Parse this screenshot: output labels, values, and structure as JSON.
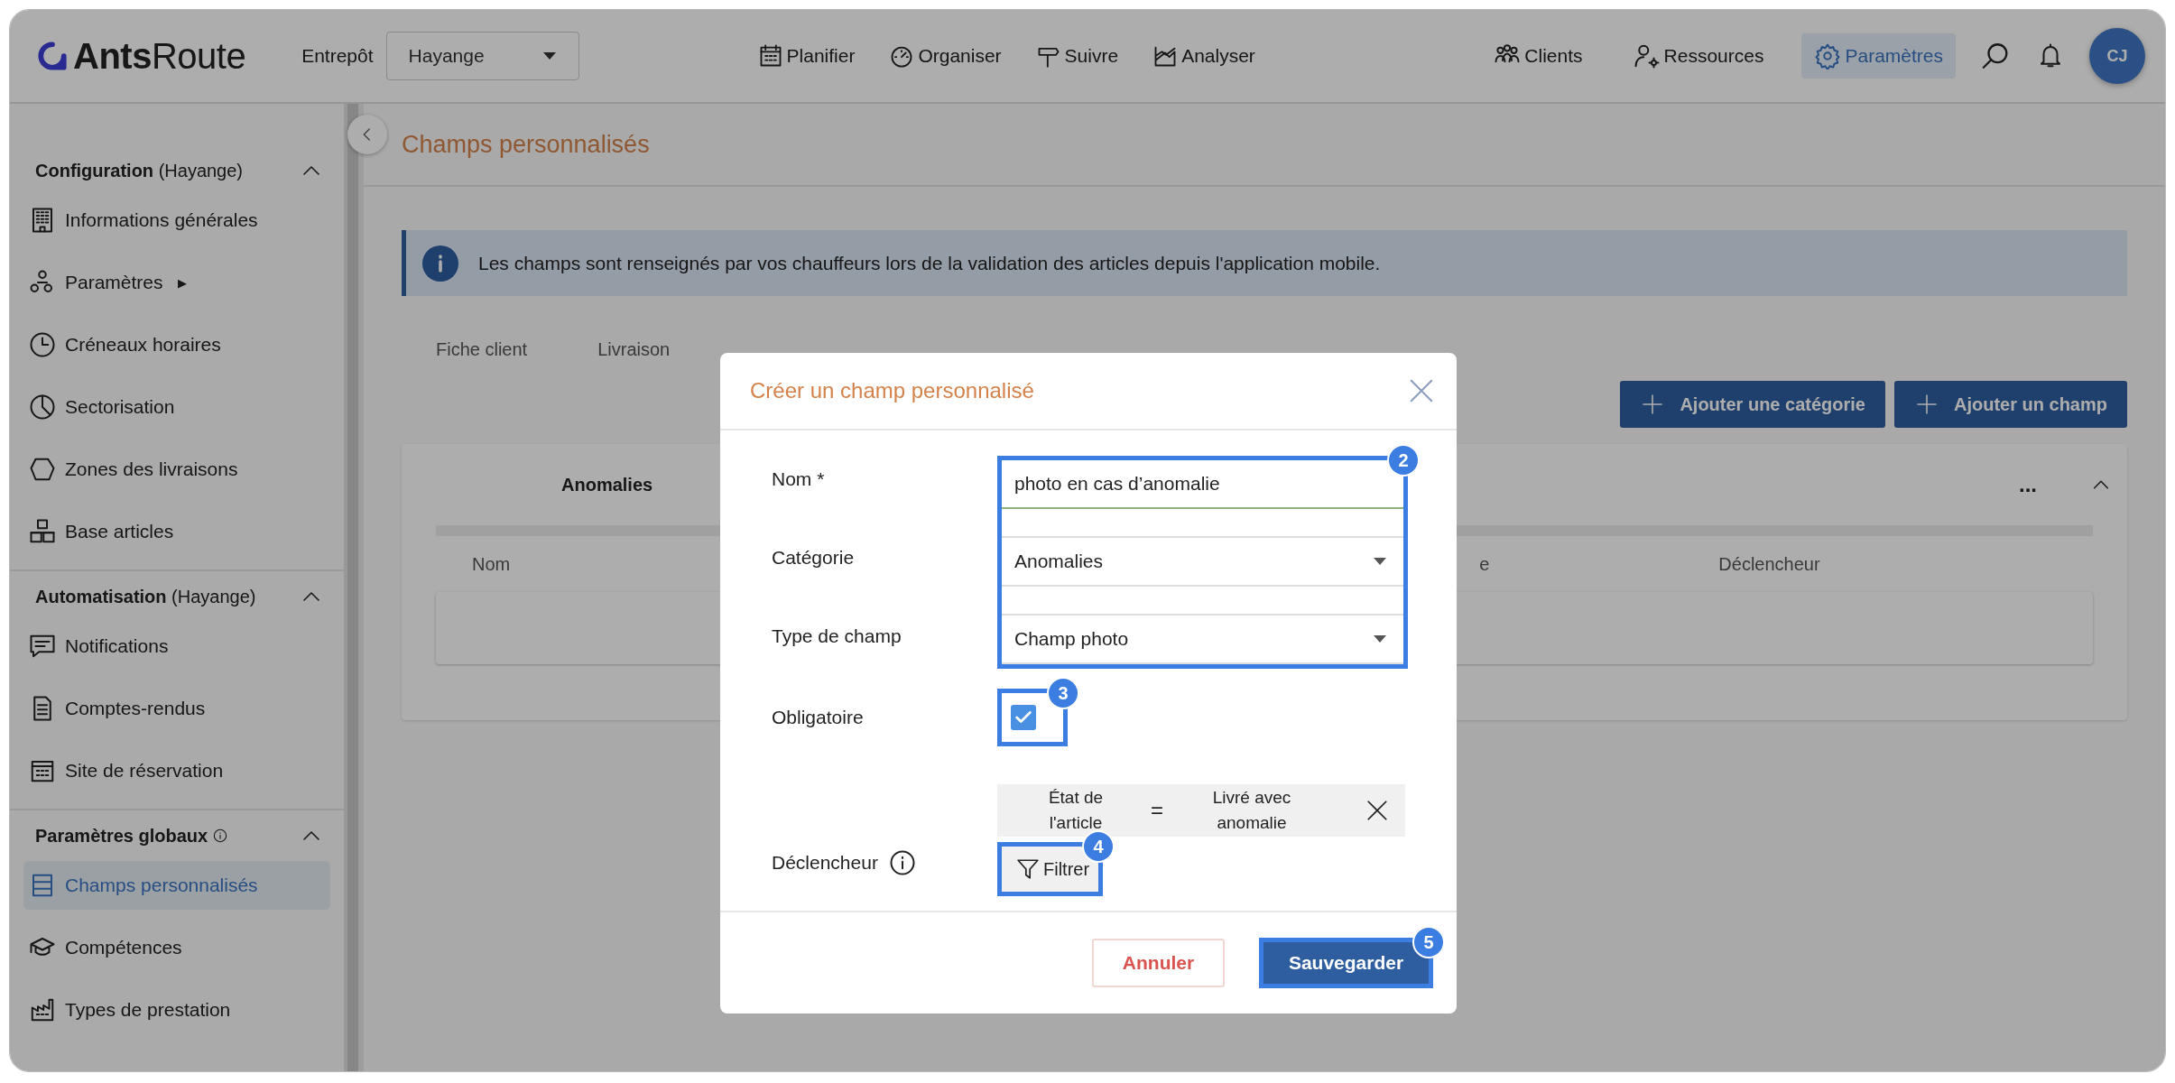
{
  "header": {
    "logo": "**Ants**Route",
    "warehouse_label": "Entrepôt",
    "warehouse": "Hayange",
    "nav": [
      {
        "label": "Planifier"
      },
      {
        "label": "Organiser"
      },
      {
        "label": "Suivre"
      },
      {
        "label": "Analyser"
      }
    ],
    "right_nav": [
      {
        "label": "Clients",
        "selected": false
      },
      {
        "label": "Ressources",
        "selected": false
      },
      {
        "label": "Paramètres",
        "selected": true
      }
    ],
    "avatar": "CJ"
  },
  "sidebar": {
    "sections": [
      {
        "title": "Configuration",
        "suffix": "(Hayange)",
        "info": false,
        "expanded": true,
        "items": [
          {
            "label": "Informations générales",
            "selected": false
          },
          {
            "label": "Paramètres",
            "marker": "▶",
            "selected": false
          },
          {
            "label": "Créneaux horaires",
            "selected": false
          },
          {
            "label": "Sectorisation",
            "selected": false
          },
          {
            "label": "Zones des livraisons",
            "selected": false
          },
          {
            "label": "Base articles",
            "selected": false
          }
        ]
      },
      {
        "title": "Automatisation",
        "suffix": "(Hayange)",
        "info": false,
        "expanded": true,
        "items": [
          {
            "label": "Notifications",
            "selected": false
          },
          {
            "label": "Comptes-rendus",
            "selected": false
          },
          {
            "label": "Site de réservation",
            "selected": false
          }
        ]
      },
      {
        "title": "Paramètres globaux",
        "info": true,
        "expanded": true,
        "items": [
          {
            "label": "Champs personnalisés",
            "selected": true
          },
          {
            "label": "Compétences",
            "selected": false
          },
          {
            "label": "Types de prestation",
            "selected": false
          }
        ]
      }
    ]
  },
  "main": {
    "title": "Champs personnalisés",
    "info_banner": "Les champs sont renseignés par vos chauffeurs lors de la validation des articles depuis l'application mobile.",
    "tabs": [
      {
        "label": "Fiche client",
        "selected": false
      },
      {
        "label": "Livraison",
        "selected": false
      }
    ],
    "buttons": [
      "Ajouter une catégorie",
      "Ajouter un champ"
    ],
    "card": {
      "title": "Anomalies",
      "more": "...",
      "expanded": true,
      "columns": [
        "Nom",
        "e",
        "Déclencheur"
      ]
    }
  },
  "modal": {
    "title": "Créer un champ personnalisé",
    "fields": [
      {
        "label": "Nom *",
        "kind": "text",
        "value": "photo en cas d’anomalie"
      },
      {
        "label": "Catégorie",
        "kind": "select",
        "value": "Anomalies"
      },
      {
        "label": "Type de champ",
        "kind": "select",
        "value": "Champ photo"
      }
    ],
    "required": {
      "label": "Obligatoire",
      "checked": true
    },
    "trigger": {
      "label": "Déclencheur",
      "field": "État de l'article",
      "operator": "=",
      "value": "Livré avec anomalie",
      "filter_button": "Filtrer"
    },
    "cancel": "Annuler",
    "save": "Sauvegarder"
  },
  "steps": [
    "2",
    "3",
    "4",
    "5"
  ]
}
